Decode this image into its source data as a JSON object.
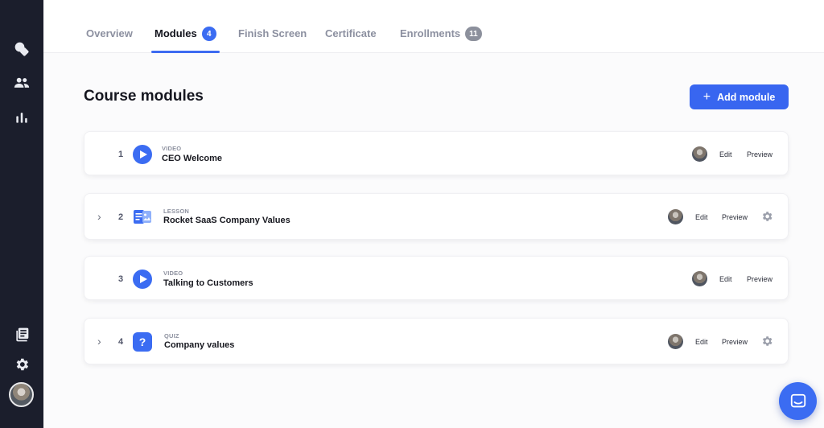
{
  "tabs": [
    {
      "label": "Overview",
      "badge": ""
    },
    {
      "label": "Modules",
      "badge": "4"
    },
    {
      "label": "Finish Screen",
      "badge": ""
    },
    {
      "label": "Certificate",
      "badge": ""
    },
    {
      "label": "Enrollments",
      "badge": "11"
    }
  ],
  "active_tab": "Modules",
  "page_title": "Course modules",
  "add_button_label": "Add module",
  "modules": [
    {
      "number": "1",
      "type": "VIDEO",
      "title": "CEO Welcome",
      "edit": "Edit",
      "preview": "Preview",
      "icon": "play-icon"
    },
    {
      "number": "2",
      "type": "LESSON",
      "title": "Rocket SaaS Company Values",
      "edit": "Edit",
      "preview": "Preview",
      "icon": "lesson-icon"
    },
    {
      "number": "3",
      "type": "VIDEO",
      "title": "Talking to Customers",
      "edit": "Edit",
      "preview": "Preview",
      "icon": "play-icon"
    },
    {
      "number": "4",
      "type": "QUIZ",
      "title": "Company values",
      "edit": "Edit",
      "preview": "Preview",
      "icon": "question-icon",
      "icon_glyph": "?"
    }
  ],
  "colors": {
    "accent": "#3b6cf2",
    "sidebar": "#1b1e2c"
  }
}
